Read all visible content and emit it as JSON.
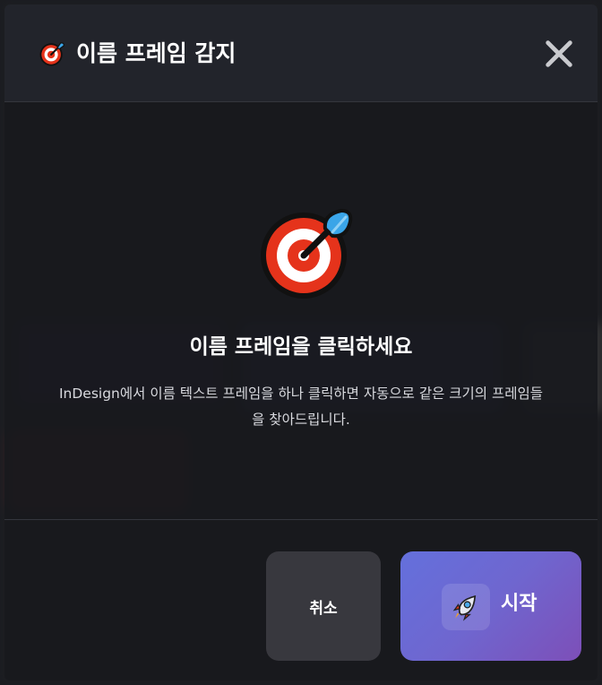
{
  "dialog": {
    "title": "이름 프레임 감지",
    "title_icon": "target-icon",
    "close_icon": "close-icon"
  },
  "content": {
    "hero_icon": "target-icon",
    "heading": "이름 프레임을 클릭하세요",
    "description": "InDesign에서 이름 텍스트 프레임을 하나 클릭하면 자동으로 같은 크기의 프레임들을 찾아드립니다."
  },
  "buttons": {
    "cancel_label": "취소",
    "start_label": "시작",
    "start_icon": "rocket-icon"
  },
  "colors": {
    "start_gradient_from": "#6470dc",
    "start_gradient_to": "#7d4fb8",
    "cancel_bg": "#38383e",
    "target_red": "#e5331b"
  }
}
